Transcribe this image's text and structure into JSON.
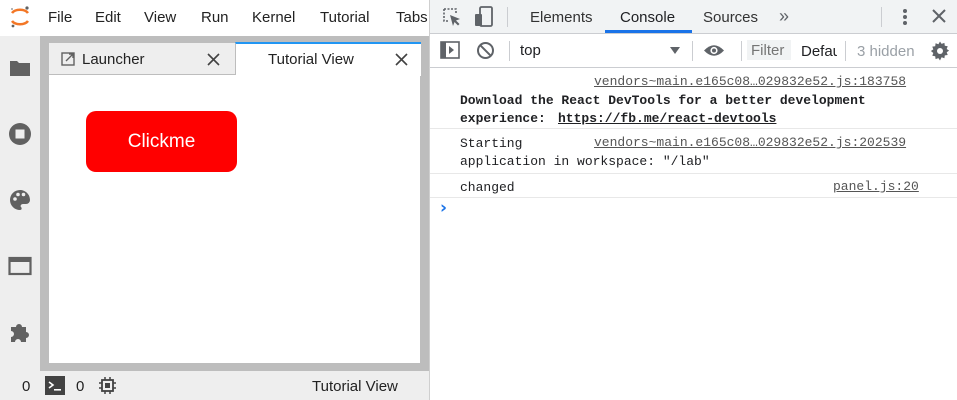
{
  "app": {
    "menu": [
      "File",
      "Edit",
      "View",
      "Run",
      "Kernel",
      "Tutorial",
      "Tabs"
    ],
    "sidebar_icons": [
      "folder-icon",
      "running-stop-icon",
      "palette-icon",
      "tabs-window-icon",
      "extension-puzzle-icon"
    ],
    "tabs": [
      {
        "label": "Launcher",
        "active": false
      },
      {
        "label": "Tutorial View",
        "active": true
      }
    ],
    "button": {
      "label": "Clickme",
      "color": "#ff0000"
    },
    "status": {
      "terminals": "0",
      "kernels": "0",
      "current": "Tutorial View"
    }
  },
  "devtools": {
    "tabs": [
      "Elements",
      "Console",
      "Sources"
    ],
    "active_tab": "Console",
    "toolbar": {
      "context": "top",
      "filter_placeholder": "Filter",
      "levels": "Defau",
      "hidden": "3 hidden"
    },
    "messages": [
      {
        "source": "vendors~main.e165c08…029832e52.js:183758",
        "line1": "Download the React DevTools for a better development",
        "line2_prefix": "experience: ",
        "link": "https://fb.me/react-devtools",
        "bold": true
      },
      {
        "source": "vendors~main.e165c08…029832e52.js:202539",
        "line1": "Starting",
        "line2": "application in workspace: \"/lab\""
      },
      {
        "source": "panel.js:20",
        "line1": "changed"
      }
    ],
    "prompt": "›",
    "accent": "#1a73e8"
  }
}
